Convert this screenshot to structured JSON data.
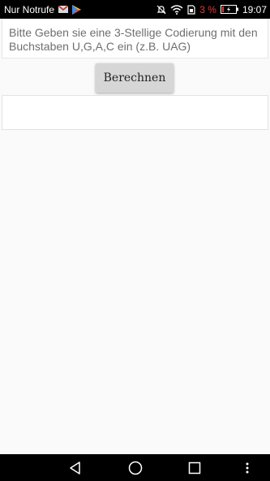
{
  "status_bar": {
    "carrier": "Nur Notrufe",
    "battery_percent": "3 %",
    "time": "19:07",
    "icons": [
      "gmail-icon",
      "play-store-icon",
      "mute-icon",
      "wifi-icon",
      "sim-icon",
      "battery-icon"
    ]
  },
  "form": {
    "input_placeholder": "Bitte Geben sie eine 3-Stellige Codierung mit den Buchstaben U,G,A,C ein (z.B. UAG)",
    "input_value": "",
    "button_label": "Berechnen",
    "result_text": ""
  },
  "nav_bar": {
    "icons": [
      "back-icon",
      "home-icon",
      "recents-icon",
      "more-icon"
    ]
  },
  "colors": {
    "status_bar_bg": "#000000",
    "battery_low": "#e53935",
    "background": "#fafafa",
    "button_bg": "#d6d6d6"
  }
}
